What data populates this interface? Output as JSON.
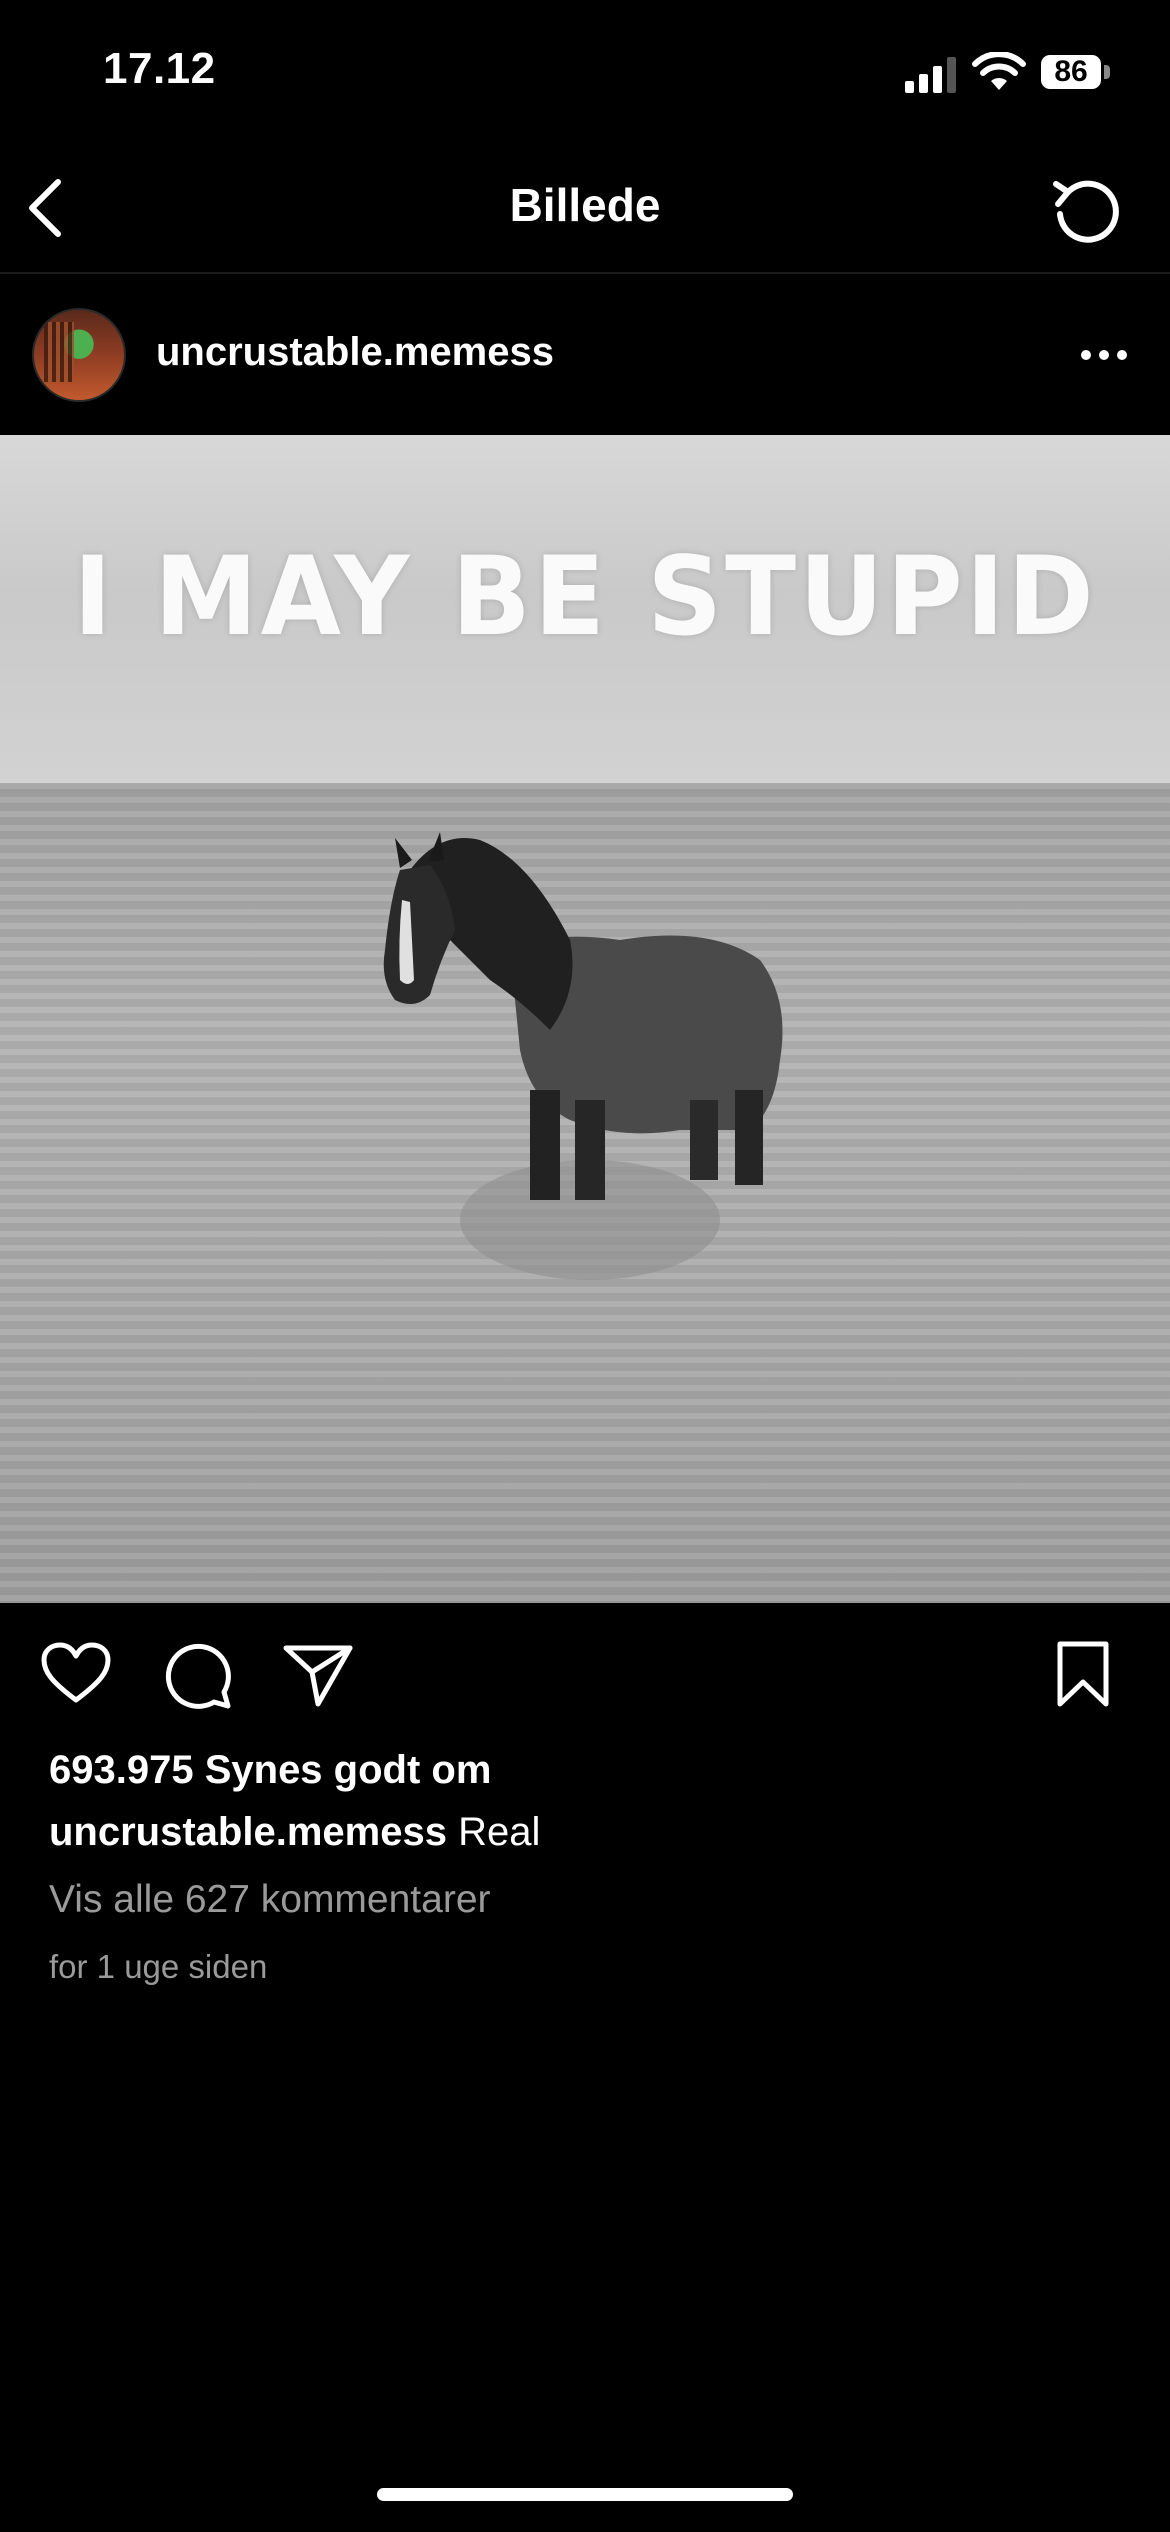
{
  "status_bar": {
    "time": "17.12",
    "battery": "86",
    "icons": [
      "signal-icon",
      "wifi-icon",
      "battery-icon"
    ]
  },
  "nav": {
    "title": "Billede",
    "icons": [
      "back-icon",
      "refresh-icon"
    ]
  },
  "post": {
    "username": "uncrustable.memess",
    "image_text": "I MAY BE STUPID",
    "icons": [
      "avatar",
      "more-icon"
    ]
  },
  "actions": {
    "icons": [
      "heart-icon",
      "comment-icon",
      "share-icon",
      "bookmark-icon"
    ]
  },
  "details": {
    "likes": "693.975 Synes godt om",
    "caption_user": "uncrustable.memess",
    "caption_text": "Real",
    "view_comments": "Vis alle 627 kommentarer",
    "timestamp": "for 1 uge siden"
  },
  "colors": {
    "background": "#000000",
    "text": "#ffffff",
    "secondary_text": "#9a9a9a"
  }
}
